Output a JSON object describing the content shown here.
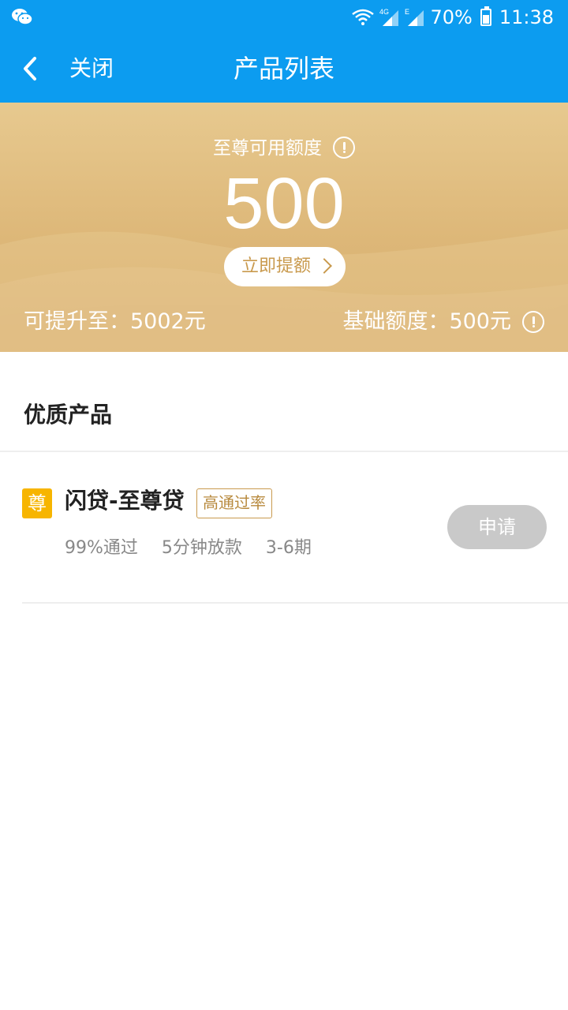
{
  "statusbar": {
    "battery_percent": "70%",
    "time": "11:38",
    "network": "4G",
    "network_secondary": "E"
  },
  "nav": {
    "close_label": "关闭",
    "title": "产品列表"
  },
  "banner": {
    "label": "至尊可用额度",
    "amount": "500",
    "raise_button": "立即提额",
    "raise_to": "可提升至：5002元",
    "base_quota": "基础额度：500元"
  },
  "section": {
    "title": "优质产品"
  },
  "product": {
    "badge": "尊",
    "name": "闪贷-至尊贷",
    "tag": "高通过率",
    "features": [
      "99%通过",
      "5分钟放款",
      "3-6期"
    ],
    "apply_label": "申请"
  },
  "colors": {
    "primary": "#0c9cf0",
    "banner_gold": "#ddb778",
    "badge": "#f7b500",
    "tag_gold": "#c99a4e",
    "apply_disabled": "#c9c9c9"
  }
}
